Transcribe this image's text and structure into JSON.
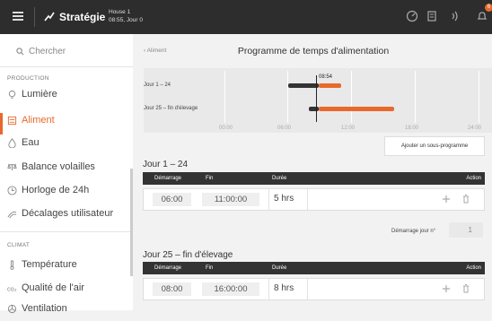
{
  "topbar": {
    "brand": "Stratégie",
    "house": "House 1",
    "time_day": "08:55, Jour 0",
    "notification_count": "6",
    "icons": [
      "menu-icon",
      "chart-line-icon",
      "dashboard-icon",
      "document-icon",
      "wireless-icon",
      "bell-icon"
    ]
  },
  "sidebar": {
    "search_placeholder": "Chercher",
    "section_production": "PRODUCTION",
    "section_climat": "CLIMAT",
    "items": [
      {
        "label": "Lumière",
        "icon": "bulb-icon"
      },
      {
        "label": "Aliment",
        "icon": "feed-icon",
        "active": true
      },
      {
        "label": "Eau",
        "icon": "water-drop-icon"
      },
      {
        "label": "Balance volailles",
        "icon": "scale-icon"
      },
      {
        "label": "Horloge de 24h",
        "icon": "clock-icon"
      },
      {
        "label": "Décalages utilisateur",
        "icon": "user-offset-icon"
      },
      {
        "label": "Température",
        "icon": "thermometer-icon"
      },
      {
        "label": "Qualité de l'air",
        "icon": "air-quality-icon"
      },
      {
        "label": "Ventilation",
        "icon": "fan-icon"
      }
    ]
  },
  "main": {
    "breadcrumb": "‹ Aliment",
    "title": "Programme de temps d'alimentation",
    "timeline": {
      "rows": [
        "Jour 1 – 24",
        "Jour 25 – fin d'élevage"
      ],
      "ticks": [
        "00:00",
        "06:00",
        "12:00",
        "18:00",
        "24:00"
      ],
      "now": "08:54",
      "bars": [
        {
          "row": 0,
          "from": 6,
          "to": 11,
          "color": "#e8692c",
          "past_until": 8.9
        },
        {
          "row": 1,
          "from": 8,
          "to": 16,
          "color": "#e8692c",
          "past_until": 8.9
        }
      ]
    },
    "add_subprogram": "Ajouter un sous-programme",
    "col_headers": {
      "start": "Démarrage",
      "end": "Fin",
      "duration": "Durée",
      "action": "Action"
    },
    "blocks": [
      {
        "title": "Jour 1 – 24",
        "start": "06:00",
        "end": "11:00:00",
        "duration": "5 hrs"
      },
      {
        "title": "Jour 25 – fin d'élevage",
        "start": "08:00",
        "end": "16:00:00",
        "duration": "8 hrs"
      }
    ],
    "start_day_label": "Démarrage jour n°",
    "start_day_value": "1"
  }
}
